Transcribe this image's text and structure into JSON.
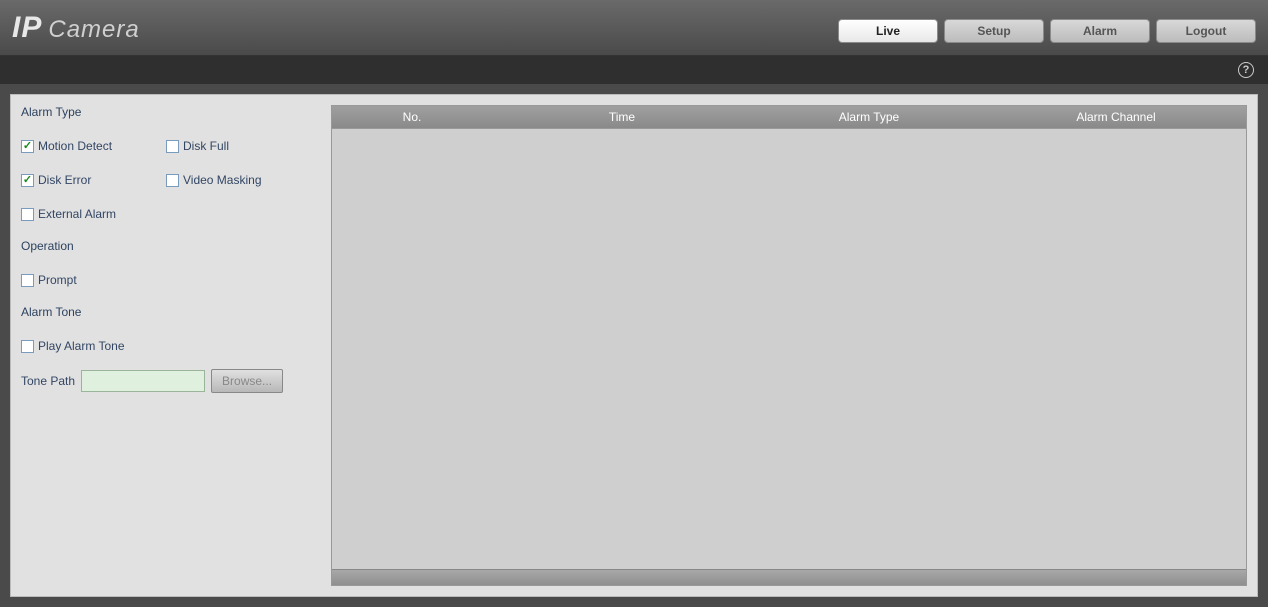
{
  "logo": {
    "ip": "IP",
    "camera": "Camera"
  },
  "nav": {
    "live": "Live",
    "setup": "Setup",
    "alarm": "Alarm",
    "logout": "Logout"
  },
  "help_glyph": "?",
  "sidebar": {
    "alarm_type_title": "Alarm Type",
    "motion_detect": "Motion Detect",
    "disk_full": "Disk Full",
    "disk_error": "Disk Error",
    "video_masking": "Video Masking",
    "external_alarm": "External Alarm",
    "operation_title": "Operation",
    "prompt": "Prompt",
    "alarm_tone_title": "Alarm Tone",
    "play_alarm_tone": "Play Alarm Tone",
    "tone_path_label": "Tone Path",
    "tone_path_value": "",
    "browse_label": "Browse..."
  },
  "table": {
    "col_no": "No.",
    "col_time": "Time",
    "col_type": "Alarm Type",
    "col_channel": "Alarm Channel",
    "rows": []
  },
  "checkbox_state": {
    "motion_detect": true,
    "disk_full": false,
    "disk_error": true,
    "video_masking": false,
    "external_alarm": false,
    "prompt": false,
    "play_alarm_tone": false
  }
}
